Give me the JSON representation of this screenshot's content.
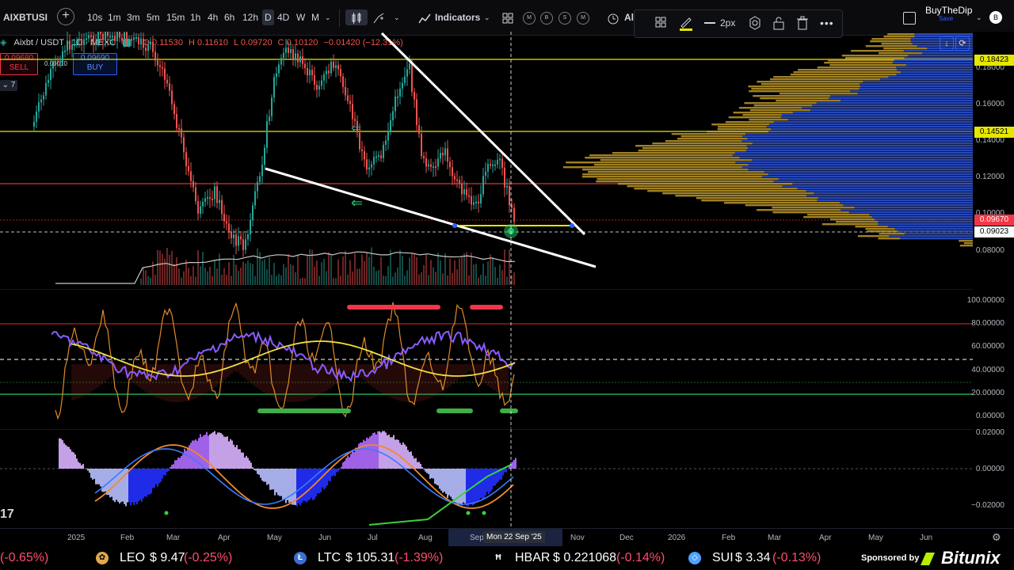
{
  "toolbar": {
    "symbol": "AIXBTUSI",
    "timeframes": [
      "10s",
      "1m",
      "3m",
      "5m",
      "15m",
      "1h",
      "4h",
      "6h",
      "12h",
      "D",
      "4D",
      "W",
      "M"
    ],
    "active_timeframe": "D",
    "indicators_label": "Indicators",
    "circle_buttons": [
      "M",
      "B",
      "S",
      "M"
    ],
    "alert_label": "Al",
    "stroke_width": "2px",
    "layout_name": "BuyTheDip",
    "layout_status": "Save",
    "avatar_letter": "B"
  },
  "legend": {
    "pair": "Aixbt / USDT · 1D · MEXC",
    "open": "O 0.11530",
    "high": "H 0.11610",
    "low": "L 0.09720",
    "close": "C 0.10120",
    "change": "−0.01420 (−12.31%)",
    "sell_price": "0.09680",
    "sell_label": "SELL",
    "spread": "0.00010",
    "buy_price": "0.09690",
    "buy_label": "BUY",
    "indicator_count": "7"
  },
  "price_axis": {
    "ticks": [
      "0.18000",
      "0.16000",
      "0.14000",
      "0.12000",
      "0.10000",
      "0.08000"
    ],
    "label_top": "0.18423",
    "label_mid": "0.14521",
    "label_current": "0.09670",
    "label_cross": "0.09023"
  },
  "osc_axis": {
    "ticks": [
      "100.00000",
      "80.00000",
      "60.00000",
      "40.00000",
      "20.00000",
      "0.00000"
    ]
  },
  "macd_axis": {
    "ticks": [
      "0.02000",
      "0.00000",
      "−0.02000"
    ]
  },
  "time_axis": {
    "labels": [
      "2025",
      "Feb",
      "Mar",
      "Apr",
      "May",
      "Jun",
      "Jul",
      "Aug",
      "Sep",
      "Nov",
      "Dec",
      "2026",
      "Feb",
      "Mar",
      "Apr",
      "May",
      "Jun"
    ],
    "crosshair_label": "Mon 22 Sep '25"
  },
  "ticker": [
    {
      "symbol": "",
      "price": "",
      "change": "(-0.65%)"
    },
    {
      "symbol": "LEO",
      "price": "$ 9.47",
      "change": "(-0.25%)"
    },
    {
      "symbol": "LTC",
      "price": "$ 105.31",
      "change": "(-1.39%)"
    },
    {
      "symbol": "HBAR",
      "price": "$ 0.221068",
      "change": "(-0.14%)"
    },
    {
      "symbol": "SUI",
      "price": "$ 3.34",
      "change": "(-0.13%)"
    }
  ],
  "sponsor": {
    "text": "Sponsored by",
    "brand": "Bitunix"
  },
  "colors": {
    "up": "#26a69a",
    "down": "#ef5350",
    "accent": "#2962ff",
    "yellow_line": "#e6e600",
    "red_line": "#e03030"
  }
}
